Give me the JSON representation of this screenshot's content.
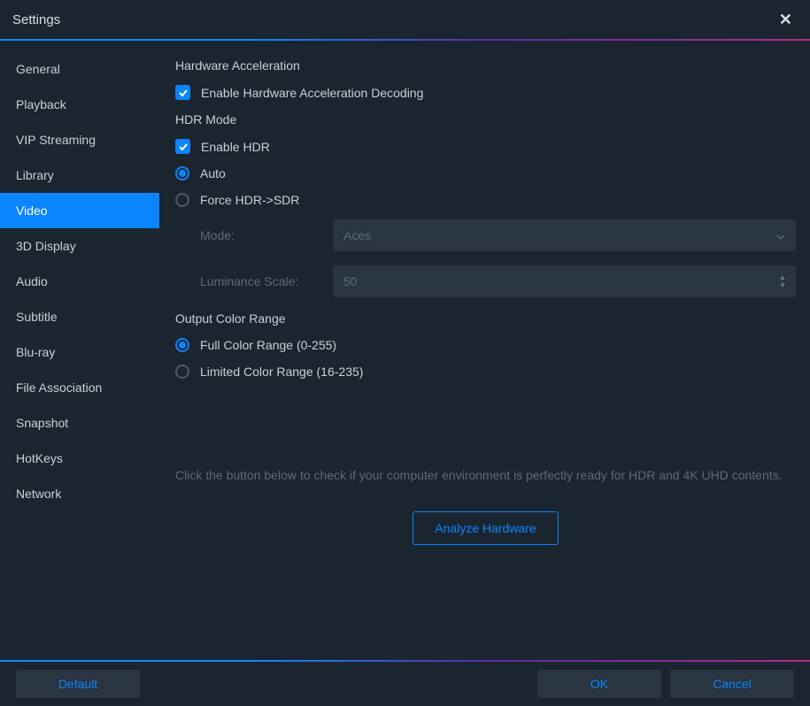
{
  "title": "Settings",
  "sidebar": {
    "items": [
      {
        "label": "General"
      },
      {
        "label": "Playback"
      },
      {
        "label": "VIP Streaming"
      },
      {
        "label": "Library"
      },
      {
        "label": "Video",
        "active": true
      },
      {
        "label": "3D Display"
      },
      {
        "label": "Audio"
      },
      {
        "label": "Subtitle"
      },
      {
        "label": "Blu-ray"
      },
      {
        "label": "File Association"
      },
      {
        "label": "Snapshot"
      },
      {
        "label": "HotKeys"
      },
      {
        "label": "Network"
      }
    ]
  },
  "sections": {
    "hwaccel": {
      "title": "Hardware Acceleration",
      "enable_label": "Enable Hardware Acceleration Decoding",
      "enabled": true
    },
    "hdr": {
      "title": "HDR Mode",
      "enable_label": "Enable HDR",
      "enabled": true,
      "radio_selected": "auto",
      "auto_label": "Auto",
      "force_label": "Force HDR->SDR",
      "mode_label": "Mode:",
      "mode_value": "Aces",
      "luminance_label": "Luminance Scale:",
      "luminance_value": "50"
    },
    "color_range": {
      "title": "Output Color Range",
      "selected": "full",
      "full_label": "Full Color Range (0-255)",
      "limited_label": "Limited Color Range (16-235)"
    }
  },
  "hint": "Click the button below to check if your computer environment is perfectly ready for HDR and 4K UHD contents.",
  "buttons": {
    "analyze": "Analyze Hardware",
    "default": "Default",
    "ok": "OK",
    "cancel": "Cancel"
  }
}
